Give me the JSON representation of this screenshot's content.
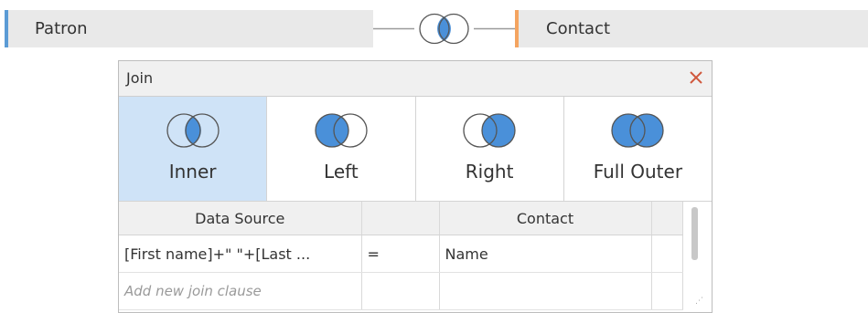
{
  "left_table": {
    "name": "Patron",
    "accent_color": "#5b9bd5"
  },
  "right_table": {
    "name": "Contact",
    "accent_color": "#f4a460"
  },
  "dialog": {
    "title": "Join",
    "close_icon": "close-icon",
    "close_color": "#d0583d",
    "join_types": [
      {
        "label": "Inner",
        "icon": "inner-join-icon",
        "selected": true
      },
      {
        "label": "Left",
        "icon": "left-join-icon",
        "selected": false
      },
      {
        "label": "Right",
        "icon": "right-join-icon",
        "selected": false
      },
      {
        "label": "Full Outer",
        "icon": "full-outer-join-icon",
        "selected": false
      }
    ],
    "venn_fill_color": "#4a90d9",
    "clause_table": {
      "headers": [
        "Data Source",
        "",
        "Contact",
        ""
      ],
      "rows": [
        [
          "[First name]+\" \"+[Last ...",
          "=",
          "Name",
          ""
        ]
      ],
      "add_clause_placeholder": "Add new join clause"
    }
  }
}
